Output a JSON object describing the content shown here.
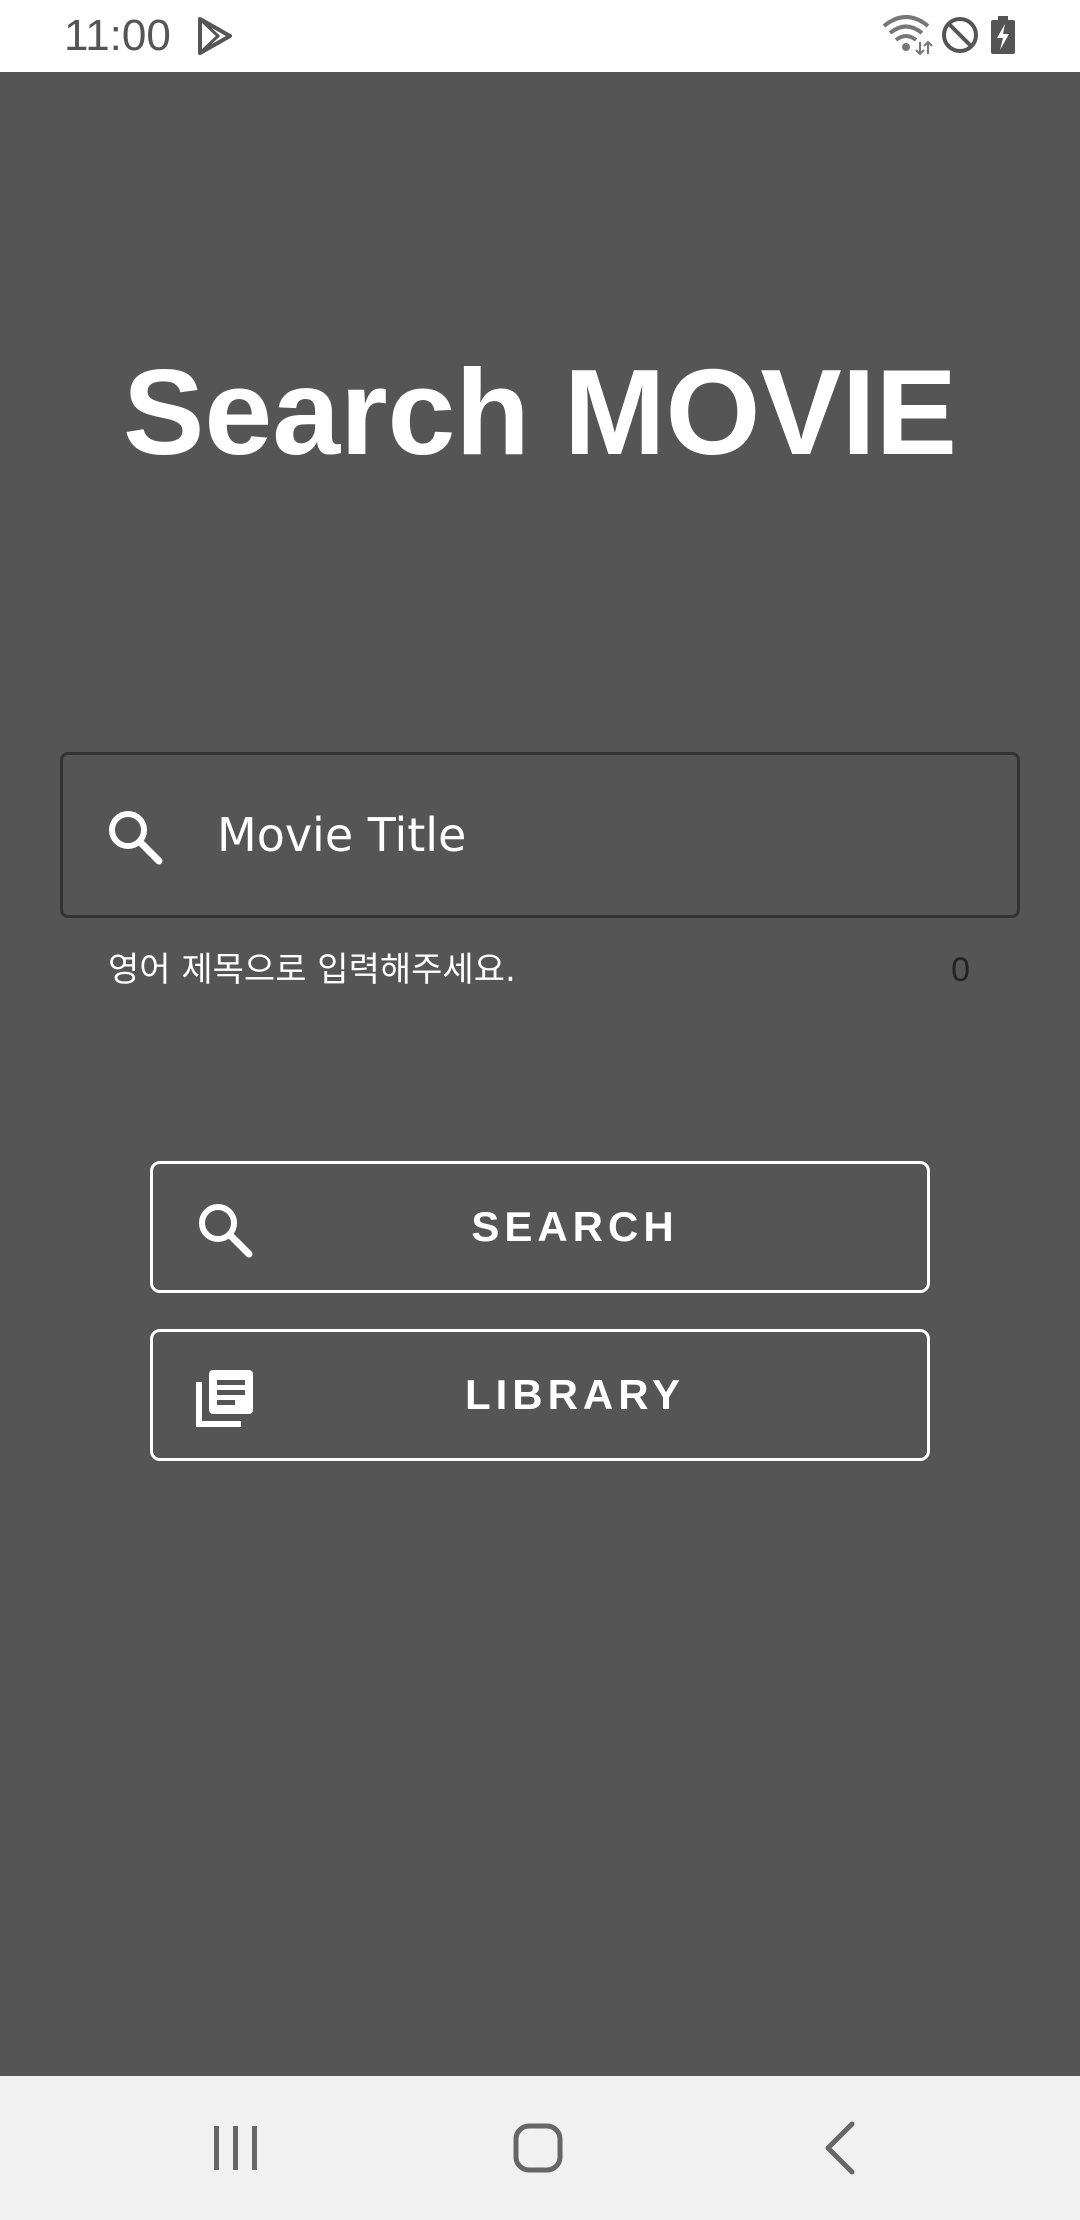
{
  "status_bar": {
    "time": "11:00",
    "icons": [
      "play-store-icon",
      "wifi-icon",
      "do-not-disturb-icon",
      "battery-charging-icon"
    ]
  },
  "app": {
    "title": "Search MOVIE",
    "search": {
      "placeholder": "Movie Title",
      "value": "",
      "helper_text": "영어 제목으로 입력해주세요.",
      "counter": "0",
      "icon": "search-icon"
    },
    "buttons": {
      "search_label": "SEARCH",
      "search_icon": "search-icon",
      "library_label": "LIBRARY",
      "library_icon": "library-books-icon"
    }
  },
  "nav_bar": {
    "icons": [
      "recent-apps-icon",
      "home-icon",
      "back-icon"
    ]
  },
  "colors": {
    "background": "#555555",
    "status_bar": "#ffffff",
    "nav_bar": "#f1f1f1",
    "text": "#ffffff",
    "field_border": "#333333"
  }
}
